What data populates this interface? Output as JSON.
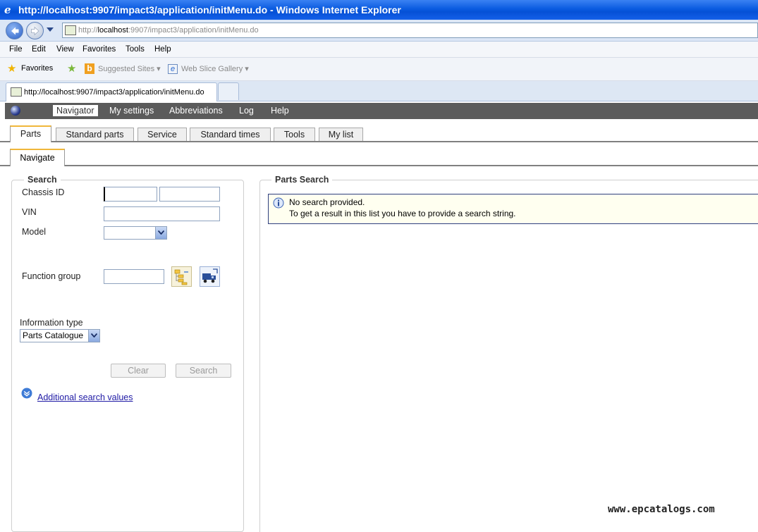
{
  "window": {
    "title": "http://localhost:9907/impact3/application/initMenu.do - Windows Internet Explorer"
  },
  "address": {
    "prefix": "http://",
    "host": "localhost",
    "rest": ":9907/impact3/application/initMenu.do"
  },
  "menu": {
    "items": [
      "File",
      "Edit",
      "View",
      "Favorites",
      "Tools",
      "Help"
    ]
  },
  "favorites_bar": {
    "favorites_label": "Favorites",
    "suggested_sites": "Suggested Sites",
    "web_slice_gallery": "Web Slice Gallery"
  },
  "browser_tab": {
    "label": "http://localhost:9907/impact3/application/initMenu.do"
  },
  "app_nav": {
    "items": [
      "Navigator",
      "My settings",
      "Abbreviations",
      "Log",
      "Help"
    ],
    "active": "Navigator"
  },
  "main_tabs": {
    "items": [
      "Parts",
      "Standard parts",
      "Service",
      "Standard times",
      "Tools",
      "My list"
    ],
    "active": "Parts"
  },
  "sub_tabs": {
    "items": [
      "Navigate"
    ],
    "active": "Navigate"
  },
  "search": {
    "legend": "Search",
    "chassis_label": "Chassis ID",
    "vin_label": "VIN",
    "model_label": "Model",
    "model_value": "",
    "function_group_label": "Function group",
    "information_type_label": "Information type",
    "information_type_value": "Parts Catalogue",
    "clear_label": "Clear",
    "search_label": "Search",
    "additional_link": "Additional search values"
  },
  "results": {
    "legend": "Parts Search",
    "info_line1": "No search provided.",
    "info_line2": "To get a result in this list you have to provide a search string."
  },
  "watermark": "www.epcatalogs.com",
  "colors": {
    "titlebar": "#0a5be0",
    "app_nav_bg": "#5b5b5b",
    "tab_accent": "#f0b73a",
    "link": "#1f1aa5",
    "info_bg": "#fffff0"
  }
}
